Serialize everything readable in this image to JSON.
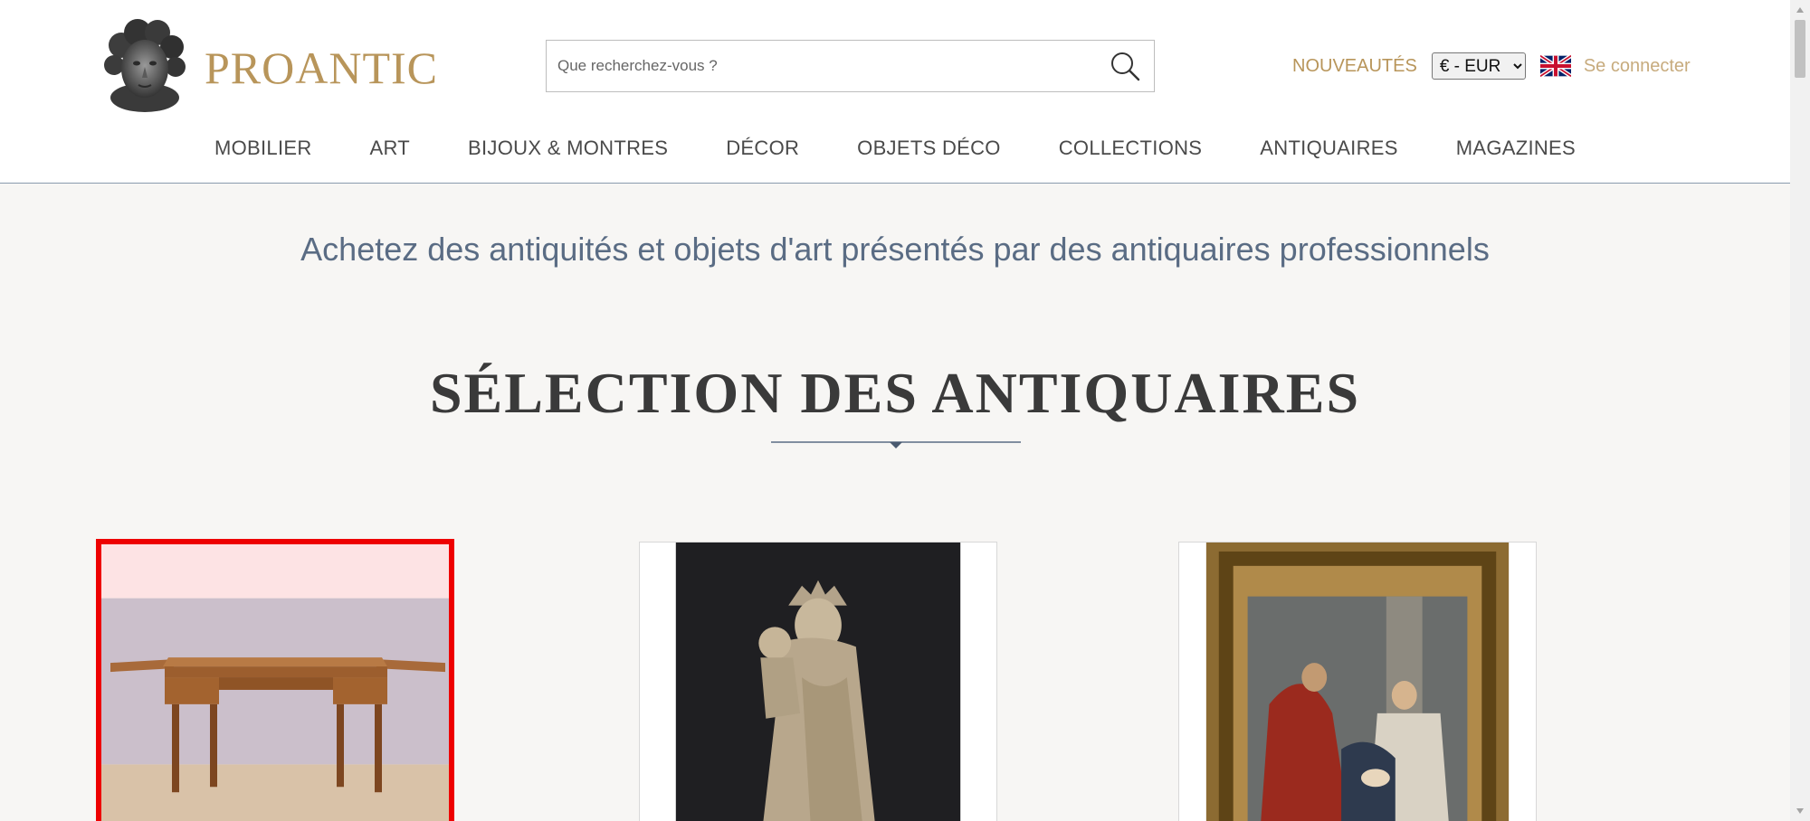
{
  "header": {
    "brand": "PROANTIC",
    "search_placeholder": "Que recherchez-vous ?",
    "nouveautes": "NOUVEAUTÉS",
    "currency_selected": "€ - EUR",
    "login": "Se connecter"
  },
  "nav": [
    {
      "label": "MOBILIER"
    },
    {
      "label": "ART"
    },
    {
      "label": "BIJOUX & MONTRES"
    },
    {
      "label": "DÉCOR"
    },
    {
      "label": "OBJETS DÉCO"
    },
    {
      "label": "COLLECTIONS"
    },
    {
      "label": "ANTIQUAIRES"
    },
    {
      "label": "MAGAZINES"
    }
  ],
  "main": {
    "tagline": "Achetez des antiquités et objets d'art présentés par des antiquaires professionnels",
    "section_title": "SÉLECTION DES ANTIQUAIRES"
  },
  "cards": [
    {
      "icon": "desk-image",
      "selected": true
    },
    {
      "icon": "madonna-statue-image",
      "selected": false
    },
    {
      "icon": "framed-painting-image",
      "selected": false
    }
  ],
  "colors": {
    "brand_gold": "#b8955a",
    "nav_text": "#4a4a4a",
    "tagline": "#5a6c84",
    "selection_border": "#ee0000",
    "background": "#f7f6f4"
  }
}
